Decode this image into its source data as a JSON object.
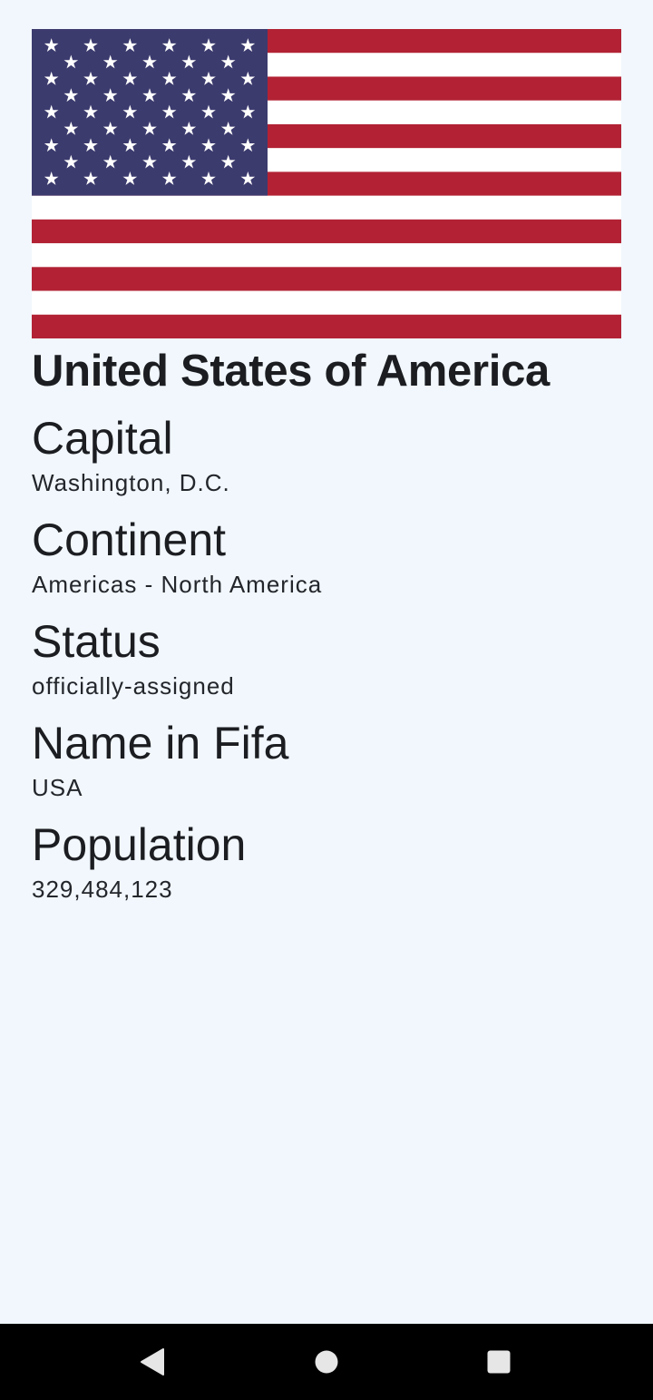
{
  "country": {
    "name": "United States of America",
    "flag_icon": "us-flag",
    "flag_colors": {
      "red": "#b22234",
      "white": "#ffffff",
      "blue": "#3c3b6e"
    }
  },
  "fields": [
    {
      "label": "Capital",
      "value": "Washington, D.C."
    },
    {
      "label": "Continent",
      "value": "Americas - North America"
    },
    {
      "label": "Status",
      "value": "officially-assigned"
    },
    {
      "label": "Name in Fifa",
      "value": "USA"
    },
    {
      "label": "Population",
      "value": "329,484,123"
    }
  ],
  "navbar": {
    "back_icon": "back-triangle-icon",
    "home_icon": "home-circle-icon",
    "recents_icon": "recents-square-icon"
  }
}
